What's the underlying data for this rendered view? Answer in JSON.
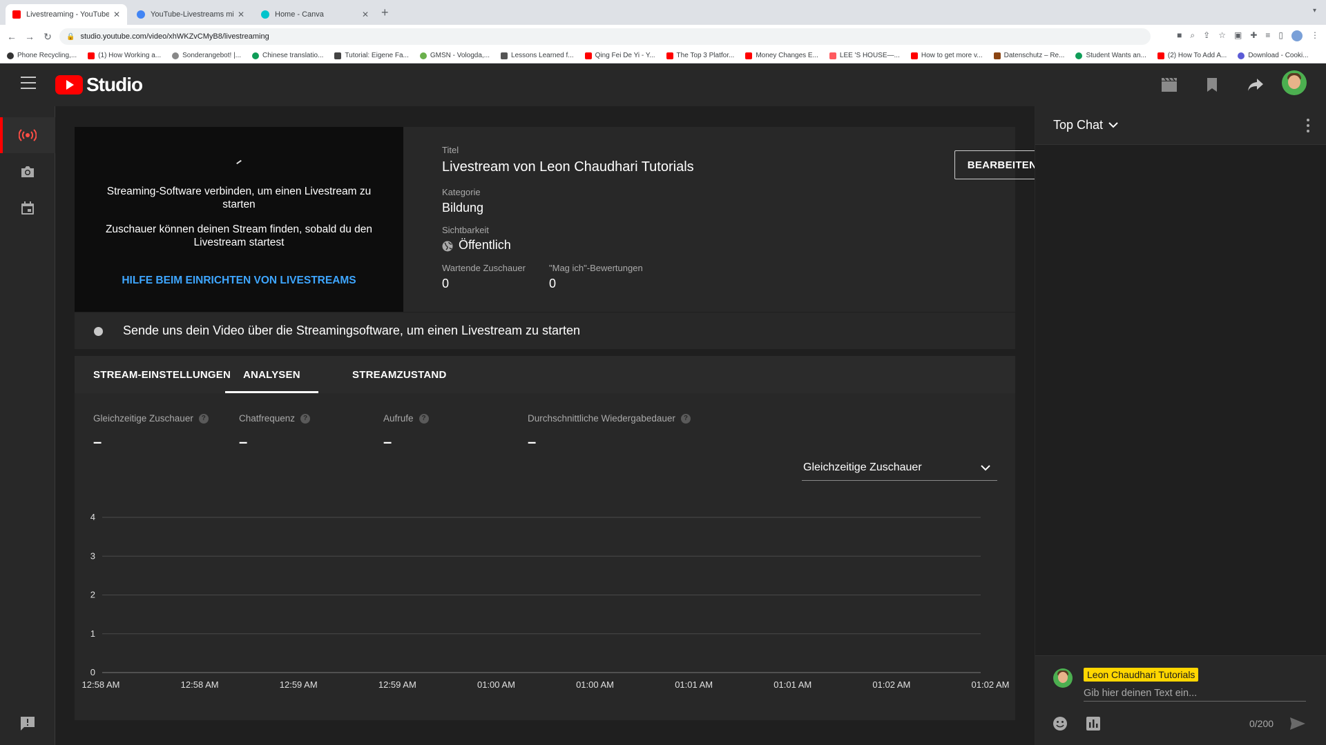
{
  "browser": {
    "tabs": [
      {
        "label": "Livestreaming - YouTube Studio",
        "close": "✕"
      },
      {
        "label": "YouTube-Livestreams mit einer...",
        "close": "✕"
      },
      {
        "label": "Home - Canva",
        "close": "✕"
      }
    ],
    "new_tab": "+",
    "url": "studio.youtube.com/video/xhWKZvCMyB8/livestreaming",
    "bookmarks": [
      "Phone Recycling,...",
      "(1) How Working a...",
      "Sonderangebot! |...",
      "Chinese translatio...",
      "Tutorial: Eigene Fa...",
      "GMSN - Vologda,...",
      "Lessons Learned f...",
      "Qing Fei De Yi - Y...",
      "The Top 3 Platfor...",
      "Money Changes E...",
      "LEE 'S HOUSE—...",
      "How to get more v...",
      "Datenschutz – Re...",
      "Student Wants an...",
      "(2) How To Add A...",
      "Download - Cooki..."
    ]
  },
  "header": {
    "logo_text": "Studio"
  },
  "preview": {
    "line1": "Streaming-Software verbinden, um einen Livestream zu starten",
    "line2": "Zuschauer können deinen Stream finden, sobald du den Livestream startest",
    "help_link": "HILFE BEIM EINRICHTEN VON LIVESTREAMS"
  },
  "details": {
    "title_label": "Titel",
    "title": "Livestream von Leon Chaudhari Tutorials",
    "category_label": "Kategorie",
    "category": "Bildung",
    "visibility_label": "Sichtbarkeit",
    "visibility": "Öffentlich",
    "waiting_label": "Wartende Zuschauer",
    "waiting_value": "0",
    "likes_label": "\"Mag ich\"-Bewertungen",
    "likes_value": "0",
    "edit_button": "BEARBEITEN"
  },
  "status": {
    "text": "Sende uns dein Video über die Streamingsoftware, um einen Livestream zu starten"
  },
  "tabs": [
    {
      "label": "STREAM-EINSTELLUNGEN",
      "active": false
    },
    {
      "label": "ANALYSEN",
      "active": true
    },
    {
      "label": "STREAMZUSTAND",
      "active": false
    }
  ],
  "metrics": [
    {
      "label": "Gleichzeitige Zuschauer",
      "value": "–"
    },
    {
      "label": "Chatfrequenz",
      "value": "–"
    },
    {
      "label": "Aufrufe",
      "value": "–"
    },
    {
      "label": "Durchschnittliche Wiedergabedauer",
      "value": "–"
    }
  ],
  "metric_select": {
    "value": "Gleichzeitige Zuschauer"
  },
  "chart_data": {
    "type": "line",
    "title": "",
    "xlabel": "",
    "ylabel": "",
    "ylim": [
      0,
      4
    ],
    "y_ticks": [
      0,
      1,
      2,
      3,
      4
    ],
    "x_ticks": [
      "12:58 AM",
      "12:58 AM",
      "12:59 AM",
      "12:59 AM",
      "01:00 AM",
      "01:00 AM",
      "01:01 AM",
      "01:01 AM",
      "01:02 AM",
      "01:02 AM"
    ],
    "series": [
      {
        "values": []
      }
    ],
    "grid": true
  },
  "chat": {
    "mode": "Top Chat",
    "user_name": "Leon Chaudhari Tutorials",
    "placeholder": "Gib hier deinen Text ein...",
    "counter": "0/200"
  },
  "colors": {
    "brand_red": "#ff0000",
    "link_blue": "#3ea6ff",
    "chat_name_bg": "#ffd600"
  }
}
